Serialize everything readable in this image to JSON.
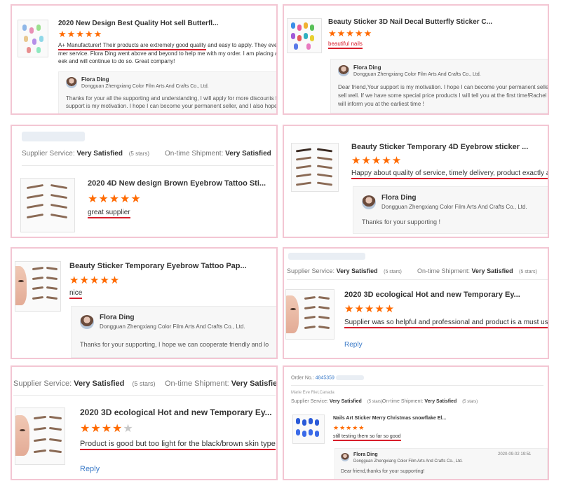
{
  "reviews": [
    {
      "title": "2020 New Design Best Quality Hot sell Butterfl...",
      "rating": 5,
      "stars": "★★★★★",
      "review_underlined": "A+ Manufacturer! Their products are extremely good quality",
      "review_rest": " and easy to apply. They even ha",
      "review_line2": "mer service. Flora Ding went above and beyond to help me with my order. I am placing anoth",
      "review_line3": "eek and will continue to do so. Great company!",
      "seller_name": "Flora Ding",
      "company": "Dongguan Zhengxiang Color Film Arts And Crafts Co., Ltd.",
      "reply_line1": "Thanks for your all the supporting and understanding, I will apply for more discounts for",
      "reply_line2": "support is my motivation. I hope I can become your permanent seller, and I also hope you"
    },
    {
      "title": "Beauty Sticker 3D Nail Decal Butterfly Sticker C...",
      "rating": 5,
      "stars": "★★★★★",
      "review_underlined": "beautiful nails",
      "seller_name": "Flora Ding",
      "company": "Dongguan Zhengxiang Color Film Arts And Crafts Co., Ltd.",
      "reply_line1": "Dear friend,Your support is my motivation. I hope I can become your permanent seller, an",
      "reply_line2": "sell well. If we have some special price products I will tell you at the first time!Rachel are o",
      "reply_line3": "will inform you at the earliest time !"
    },
    {
      "supplier_label": "Supplier Service:",
      "supplier_value": "Very Satisfied",
      "supplier_stars": "(5 stars)",
      "shipment_label": "On-time Shipment:",
      "shipment_value": "Very Satisfied",
      "title": "2020 4D New design Brown Eyebrow Tattoo Sti...",
      "rating": 5,
      "stars": "★★★★★",
      "review_underlined": "great supplier"
    },
    {
      "title": "Beauty Sticker Temporary 4D Eyebrow sticker ...",
      "rating": 5,
      "stars": "★★★★★",
      "review_underlined": "Happy about quality of service, timely delivery, product exactly as it i",
      "seller_name": "Flora Ding",
      "company": "Dongguan Zhengxiang Color Film Arts And Crafts Co., Ltd.",
      "reply_line1": "Thanks for your supporting !"
    },
    {
      "title": "Beauty Sticker Temporary Eyebrow Tattoo Pap...",
      "rating": 5,
      "stars": "★★★★★",
      "review_underlined": "nice",
      "seller_name": "Flora Ding",
      "company": "Dongguan Zhengxiang Color Film Arts And Crafts Co., Ltd.",
      "reply_line1": "Thanks for your supporting, I hope we can cooperate friendly and lo"
    },
    {
      "supplier_label": "Supplier Service:",
      "supplier_value": "Very Satisfied",
      "supplier_stars": "(5 stars)",
      "shipment_label": "On-time Shipment:",
      "shipment_value": "Very Satisfied",
      "shipment_stars": "(5 stars)",
      "title": "2020 3D ecological Hot and new Temporary Ey...",
      "rating": 5,
      "stars": "★★★★★",
      "review_underlined": "Supplier was so helpful and professional and product is a must use.it c",
      "reply_label": "Reply"
    },
    {
      "supplier_label": "Supplier Service:",
      "supplier_value": "Very Satisfied",
      "supplier_stars": "(5 stars)",
      "shipment_label": "On-time Shipment:",
      "shipment_value": "Very Satisfied",
      "title": "2020 3D ecological Hot and new Temporary Ey...",
      "rating": 4,
      "stars": "★★★★",
      "stars_empty": "★",
      "review_underlined": "Product is good but too light for the black/brown skin type",
      "reply_label": "Reply"
    },
    {
      "order_label": "Order No.:",
      "order_number": "4845359",
      "buyer_location": "Marie Eve Riel,Canada",
      "supplier_label": "Supplier Service:",
      "supplier_value": "Very Satisfied",
      "supplier_stars": "(5 stars)",
      "shipment_label": "On-time Shipment:",
      "shipment_value": "Very Satisfied",
      "shipment_stars": "(5 stars)",
      "title": "Nails Art Sticker Merry Christmas snowflake El...",
      "rating": 5,
      "stars": "★★★★★",
      "review_underlined": "still testing them so far so good",
      "seller_name": "Flora Ding",
      "company": "Dongguan Zhengxiang Color Film Arts And Crafts Co., Ltd.",
      "reply_date": "2020-09-02 19:51",
      "reply_line1": "Dear friend,thanks for your supporting!"
    }
  ],
  "colors": {
    "star": "#ff6a00",
    "underline": "#d81e2c",
    "border": "#f3c6d3",
    "link": "#3a7ac8"
  }
}
